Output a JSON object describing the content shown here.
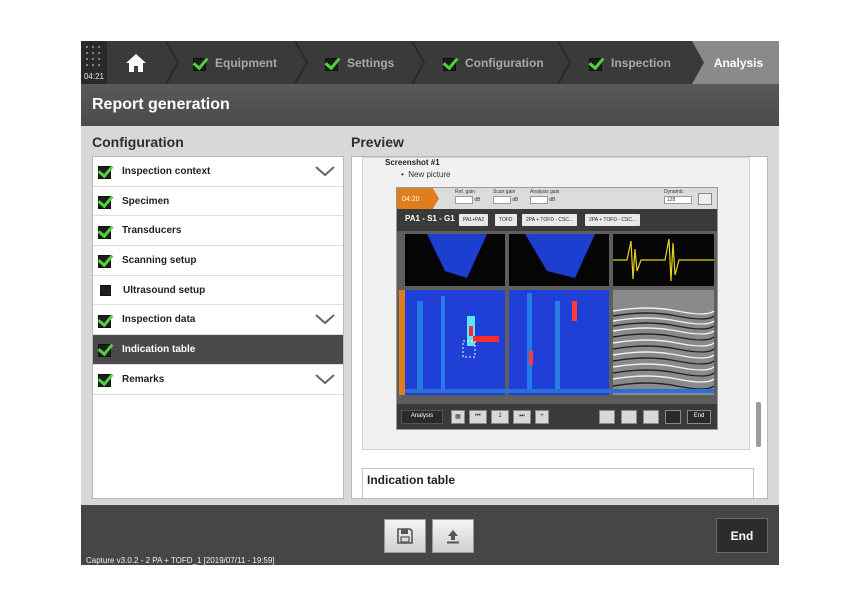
{
  "nav": {
    "clock_time": "04:21",
    "steps": [
      {
        "label": "Equipment",
        "done": true
      },
      {
        "label": "Settings",
        "done": true
      },
      {
        "label": "Configuration",
        "done": true
      },
      {
        "label": "Inspection",
        "done": true
      },
      {
        "label": "Analysis",
        "done": false,
        "active": true
      }
    ]
  },
  "title": "Report generation",
  "configuration": {
    "heading": "Configuration",
    "items": [
      {
        "label": "Inspection context",
        "checked": true,
        "expandable": true
      },
      {
        "label": "Specimen",
        "checked": true,
        "expandable": false
      },
      {
        "label": "Transducers",
        "checked": true,
        "expandable": false
      },
      {
        "label": "Scanning setup",
        "checked": true,
        "expandable": false
      },
      {
        "label": "Ultrasound setup",
        "checked": false,
        "expandable": false
      },
      {
        "label": "Inspection data",
        "checked": true,
        "expandable": true
      },
      {
        "label": "Indication table",
        "checked": true,
        "expandable": false,
        "selected": true
      },
      {
        "label": "Remarks",
        "checked": true,
        "expandable": true
      }
    ]
  },
  "preview": {
    "heading": "Preview",
    "screenshot_title": "Screenshot #1",
    "bullet": "New picture",
    "next_section": "Indication table",
    "mini": {
      "clock": "04:20",
      "gains": [
        "Ref. gain",
        "Scan gain",
        "Analysis gain"
      ],
      "gain_unit": "dB",
      "dynamic_label": "Dynamic",
      "dynamic_value": "128",
      "group": "PA1 - S1 - G1",
      "tabs": [
        "PA1+PA2",
        "TOFD",
        "2PA + TOFD - CSC...",
        "2PA + TOFD - CSC..."
      ],
      "mode": "Analysis",
      "page": "1",
      "end": "End"
    }
  },
  "bottom": {
    "end_label": "End",
    "status": "Capture v3.0.2 - 2 PA + TOFD_1 [2019/07/11 - 19:59]"
  }
}
